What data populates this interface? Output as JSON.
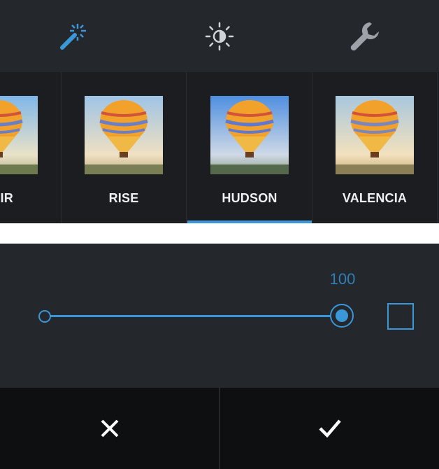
{
  "toolbar": {
    "tools": [
      {
        "icon": "magic-wand-icon",
        "color": "#3a97d8",
        "active": true
      },
      {
        "icon": "brightness-icon",
        "color": "#cfd2d6",
        "active": false
      },
      {
        "icon": "wrench-icon",
        "color": "#9ea2a8",
        "active": false
      }
    ]
  },
  "filters": {
    "items": [
      {
        "label": "FAIR",
        "selected": false
      },
      {
        "label": "RISE",
        "selected": false
      },
      {
        "label": "HUDSON",
        "selected": true
      },
      {
        "label": "VALENCIA",
        "selected": false
      }
    ]
  },
  "slider": {
    "value": "100",
    "accent_color": "#3a97d8",
    "frame_toggle_icon": "square-frame-icon"
  },
  "actions": {
    "cancel_icon": "close-icon",
    "confirm_icon": "check-icon"
  }
}
